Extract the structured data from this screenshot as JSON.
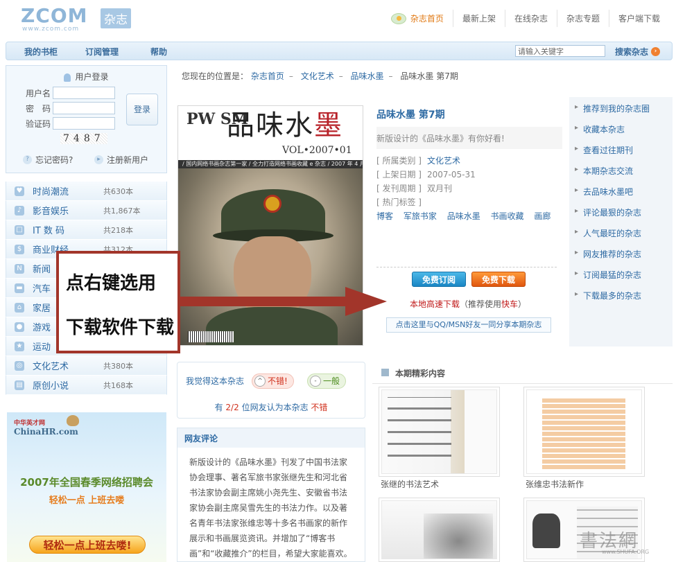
{
  "header": {
    "logo_text": "ZCOM",
    "logo_url": "www.zcom.com",
    "logo_badge": "杂志",
    "nav": [
      "杂志首页",
      "最新上架",
      "在线杂志",
      "杂志专题",
      "客户端下载"
    ]
  },
  "navbar": {
    "items": [
      "我的书柜",
      "订阅管理",
      "帮助"
    ],
    "search_placeholder": "请输入关键字",
    "search_label": "搜索杂志"
  },
  "login": {
    "title": "用户登录",
    "username_label": "用户名",
    "password_label": "密　码",
    "captcha_label": "验证码",
    "captcha_value": "7487",
    "login_button": "登录",
    "forgot": "忘记密码?",
    "register": "注册新用户"
  },
  "categories": [
    {
      "name": "时尚潮流",
      "count": "共630本",
      "icon": "♥"
    },
    {
      "name": "影音娱乐",
      "count": "共1,867本",
      "icon": "♪"
    },
    {
      "name": "IT 数 码",
      "count": "共218本",
      "icon": "□"
    },
    {
      "name": "商业财经",
      "count": "共312本",
      "icon": "$"
    },
    {
      "name": "新闻",
      "count": "",
      "icon": "N"
    },
    {
      "name": "汽车",
      "count": "",
      "icon": "▬"
    },
    {
      "name": "家居",
      "count": "",
      "icon": "⌂"
    },
    {
      "name": "游戏",
      "count": "",
      "icon": "●"
    },
    {
      "name": "运动",
      "count": "",
      "icon": "★"
    },
    {
      "name": "文化艺术",
      "count": "共380本",
      "icon": "◎"
    },
    {
      "name": "原创小说",
      "count": "共168本",
      "icon": "▤"
    }
  ],
  "ad": {
    "brand": "ChinaHR.com",
    "brand_sub": "中华英才网",
    "headline": "2007年全国春季网络招聘会",
    "sub": "轻松一点  上班去喽",
    "pill": "轻松一点上班去喽!"
  },
  "breadcrumb": {
    "prefix": "您现在的位置是：",
    "items": [
      "杂志首页",
      "文化艺术",
      "品味水墨"
    ],
    "current": "品味水墨 第7期"
  },
  "cover": {
    "brand": "PW SM",
    "title_main": "品味水",
    "title_red": "墨",
    "vol": "VOL•2007•01",
    "strip": "/ 国内网络书画杂志第一家 / 全力打造网络书画收藏 e 杂志 / 2007 年 4 月 /"
  },
  "overlay": {
    "line1": "点右键选用",
    "line2": "下载软件下载"
  },
  "magazine": {
    "title": "品味水墨  第7期",
    "desc": "新版设计的《品味水墨》有你好看!",
    "fields": [
      {
        "label": "[ 所属类别 ]",
        "value": "文化艺术",
        "link": true
      },
      {
        "label": "[ 上架日期 ]",
        "value": "2007-05-31",
        "link": false
      },
      {
        "label": "[ 发刊周期 ]",
        "value": "双月刊",
        "link": false
      },
      {
        "label": "[ 热门标签 ]",
        "value": "",
        "link": false
      }
    ],
    "tags": [
      "博客",
      "军旅书家",
      "品味水墨",
      "书画收藏",
      "画廊"
    ],
    "subscribe_button": "免费订阅",
    "download_button": "免费下载",
    "dl_note_red": "本地高速下载",
    "dl_note_mid": "（推荐使用",
    "dl_note_red2": "快车",
    "dl_note_end": "）",
    "share": "点击这里与QQ/MSN好友一同分享本期杂志"
  },
  "right_links": [
    "推荐到我的杂志圈",
    "收藏本杂志",
    "查看过往期刊",
    "本期杂志交流",
    "去品味水墨吧",
    "评论最狠的杂志",
    "人气最旺的杂志",
    "网友推荐的杂志",
    "订阅最猛的杂志",
    "下载最多的杂志"
  ],
  "vote": {
    "question": "我觉得这本杂志",
    "good": "不错!",
    "ok": "一般",
    "result_prefix": "有",
    "result_count": "2/2",
    "result_mid": "位网友认为本杂志",
    "result_verdict": "不错"
  },
  "comments": {
    "title": "网友评论",
    "body": "新版设计的《品味水墨》刊发了中国书法家协会理事、著名军旅书家张继先生和河北省书法家协会副主席姚小尧先生、安徽省书法家协会副主席吴雪先生的书法力作。以及著名青年书法家张维忠等十多名书画家的新作展示和书画展览资讯。并增加了“博客书画”和“收藏推介”的栏目，希望大家能喜欢。"
  },
  "highlights": {
    "title": "本期精彩内容",
    "items": [
      "张继的书法艺术",
      "张维忠书法新作"
    ]
  },
  "watermark": {
    "text": "書法網",
    "sub": "www.SHUFA.ORG"
  }
}
